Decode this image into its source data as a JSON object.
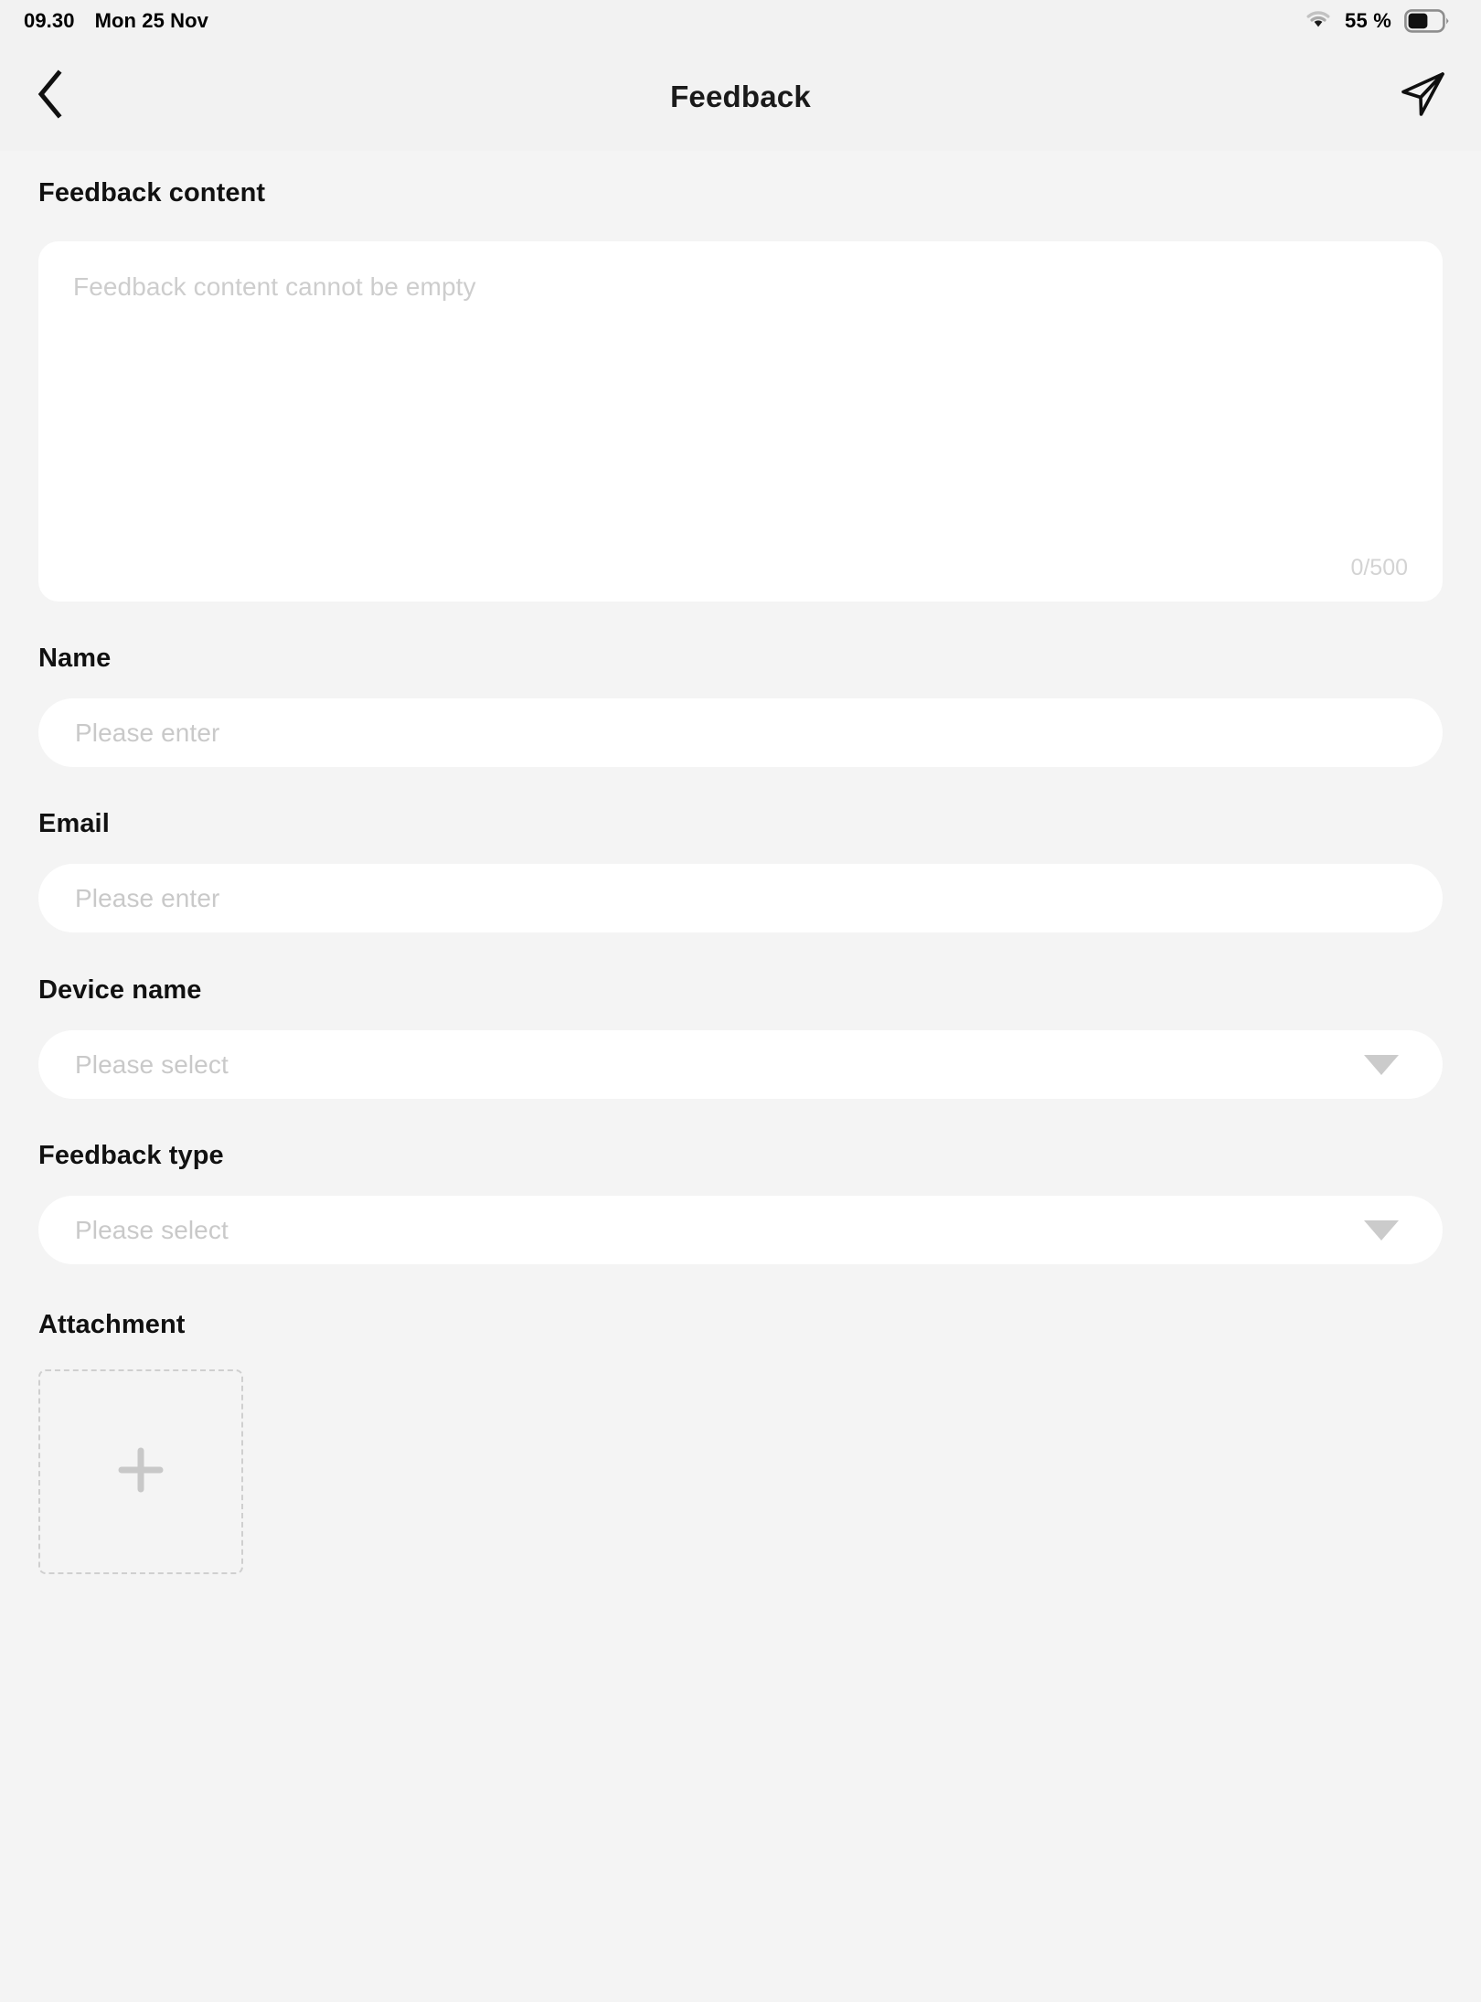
{
  "status_bar": {
    "time": "09.30",
    "date": "Mon 25 Nov",
    "battery_percent": "55 %",
    "battery_level": 55,
    "wifi_icon": "wifi-icon",
    "battery_icon": "battery-icon"
  },
  "nav_bar": {
    "title": "Feedback",
    "back_icon": "chevron-left-icon",
    "send_icon": "send-paper-plane-icon"
  },
  "form": {
    "feedback_content": {
      "label": "Feedback content",
      "placeholder": "Feedback content cannot be empty",
      "value": "",
      "counter": "0/500",
      "max_length": 500
    },
    "name": {
      "label": "Name",
      "placeholder": "Please enter",
      "value": ""
    },
    "email": {
      "label": "Email",
      "placeholder": "Please enter",
      "value": ""
    },
    "device_name": {
      "label": "Device name",
      "placeholder": "Please select",
      "value": "",
      "caret_icon": "caret-down-icon"
    },
    "feedback_type": {
      "label": "Feedback type",
      "placeholder": "Please select",
      "value": "",
      "caret_icon": "caret-down-icon"
    },
    "attachment": {
      "label": "Attachment",
      "add_icon": "plus-icon"
    }
  },
  "colors": {
    "page_background": "#f4f4f4",
    "bar_background": "#f2f2f2",
    "card_background": "#ffffff",
    "label_text": "#111111",
    "placeholder_text": "#c9c9c9",
    "icon_gray": "#cbcbcb"
  }
}
